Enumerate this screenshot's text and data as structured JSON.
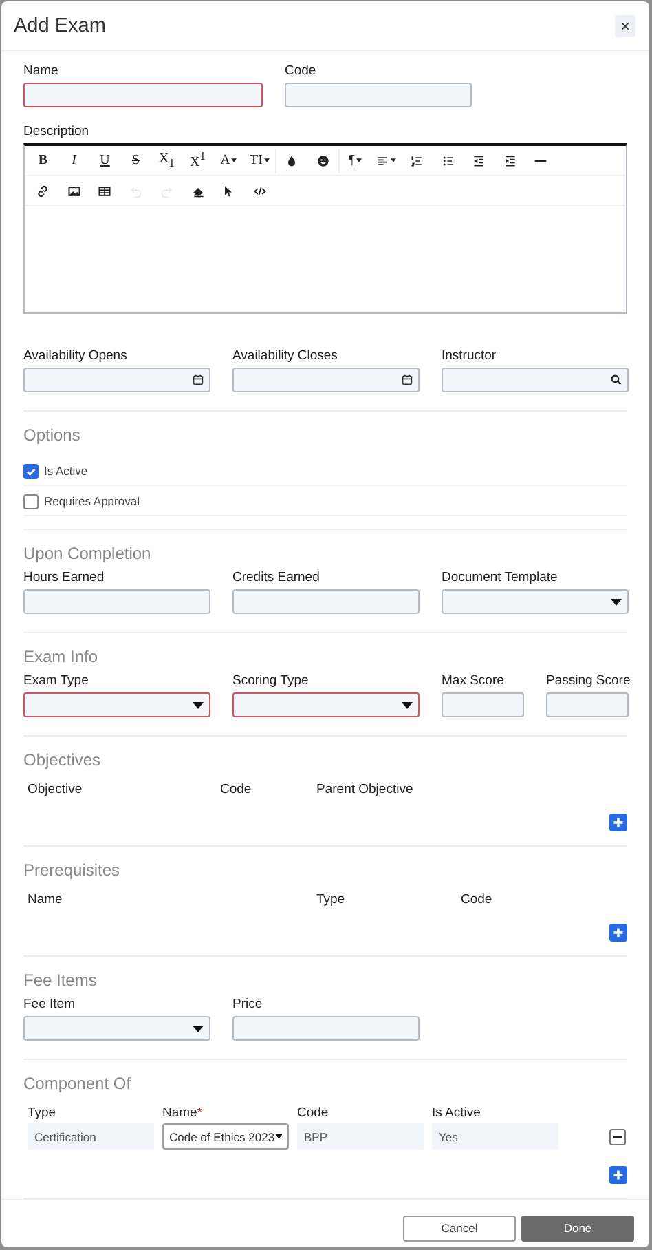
{
  "dialog": {
    "title": "Add Exam",
    "close": "×"
  },
  "top_fields": [
    {
      "label": "Name",
      "invalid": true
    },
    {
      "label": "Code",
      "invalid": false
    }
  ],
  "description": {
    "label": "Description",
    "toolbar": [
      [
        [
          {
            "kind": "bold",
            "label": "B",
            "dropdown": false,
            "disabled": false
          },
          {
            "kind": "italic",
            "label": "I",
            "dropdown": false,
            "disabled": false
          },
          {
            "kind": "underline",
            "label": "U",
            "dropdown": false,
            "disabled": false
          },
          {
            "kind": "strike",
            "label": "S",
            "dropdown": false,
            "disabled": false
          },
          {
            "kind": "text",
            "label": "X$_{1}$",
            "dropdown": false,
            "disabled": false
          },
          {
            "kind": "text",
            "label": "X$^{1}$",
            "dropdown": false,
            "disabled": false
          },
          {
            "kind": "text",
            "label": "A",
            "dropdown": true,
            "disabled": false
          },
          {
            "kind": "text",
            "label": "TI",
            "dropdown": true,
            "disabled": false
          }
        ],
        [
          {
            "kind": "drop",
            "dropdown": false,
            "disabled": false
          },
          {
            "kind": "emoji",
            "dropdown": false,
            "disabled": false
          }
        ],
        [
          {
            "kind": "text",
            "label": "¶",
            "dropdown": true,
            "disabled": false
          },
          {
            "kind": "align",
            "dropdown": true,
            "disabled": false
          },
          {
            "kind": "ol",
            "dropdown": false,
            "disabled": false
          },
          {
            "kind": "ul",
            "dropdown": false,
            "disabled": false
          },
          {
            "kind": "outdent",
            "dropdown": false,
            "disabled": false
          },
          {
            "kind": "indent",
            "dropdown": false,
            "disabled": false
          },
          {
            "kind": "hr",
            "dropdown": false,
            "disabled": false
          }
        ]
      ],
      [
        [
          {
            "kind": "link",
            "dropdown": false,
            "disabled": false
          },
          {
            "kind": "image",
            "dropdown": false,
            "disabled": false
          },
          {
            "kind": "table",
            "dropdown": false,
            "disabled": false
          },
          {
            "kind": "undo",
            "dropdown": false,
            "disabled": true
          },
          {
            "kind": "redo",
            "dropdown": false,
            "disabled": true
          },
          {
            "kind": "eraser",
            "dropdown": false,
            "disabled": false
          },
          {
            "kind": "cursor",
            "dropdown": false,
            "disabled": false
          },
          {
            "kind": "code",
            "dropdown": false,
            "disabled": false
          }
        ]
      ]
    ]
  },
  "availability": [
    {
      "label": "Availability Opens",
      "kind": "date",
      "invalid": false
    },
    {
      "label": "Availability Closes",
      "kind": "date",
      "invalid": false
    },
    {
      "label": "Instructor",
      "kind": "search",
      "invalid": false
    }
  ],
  "sections": [
    {
      "kind": "checks",
      "title": "Options",
      "items": [
        {
          "label": "Is Active",
          "checked": true
        },
        {
          "label": "Requires Approval",
          "checked": false
        }
      ]
    },
    {
      "kind": "fields",
      "title": "Upon Completion",
      "fields": [
        {
          "label": "Hours Earned",
          "kind": "text",
          "invalid": false
        },
        {
          "label": "Credits Earned",
          "kind": "text",
          "invalid": false
        },
        {
          "label": "Document Template",
          "kind": "select",
          "invalid": false
        }
      ]
    },
    {
      "kind": "fields",
      "title": "Exam Info",
      "fields": [
        {
          "label": "Exam Type",
          "kind": "select",
          "invalid": true
        },
        {
          "label": "Scoring Type",
          "kind": "select",
          "invalid": true
        },
        {
          "label": "Max Score",
          "kind": "text",
          "invalid": false
        },
        {
          "label": "Passing Score",
          "kind": "text",
          "invalid": false
        }
      ]
    },
    {
      "kind": "table",
      "title": "Objectives",
      "columns": [
        {
          "label": "Objective"
        },
        {
          "label": "Code"
        },
        {
          "label": "Parent Objective"
        }
      ]
    },
    {
      "kind": "table",
      "title": "Prerequisites",
      "columns": [
        {
          "label": "Name"
        },
        {
          "label": "Type"
        },
        {
          "label": "Code"
        }
      ]
    },
    {
      "kind": "fields",
      "title": "Fee Items",
      "fields": [
        {
          "label": "Fee Item",
          "kind": "select",
          "invalid": false
        },
        {
          "label": "Price",
          "kind": "text",
          "invalid": false
        }
      ]
    },
    {
      "kind": "table",
      "title": "Component Of",
      "columns": [
        {
          "label": "Type"
        },
        {
          "label": "Name",
          "required_mark": "*"
        },
        {
          "label": "Code"
        },
        {
          "label": "Is Active"
        }
      ],
      "rows": [
        [
          {
            "kind": "readonly",
            "value": "Certification"
          },
          {
            "kind": "select",
            "value": "Code of Ethics 2023"
          },
          {
            "kind": "readonly",
            "value": "BPP"
          },
          {
            "kind": "readonly",
            "value": "Yes"
          }
        ]
      ]
    }
  ],
  "buttons": [
    {
      "label": "Cancel",
      "kind": "secondary"
    },
    {
      "label": "Done",
      "kind": "primary"
    }
  ]
}
